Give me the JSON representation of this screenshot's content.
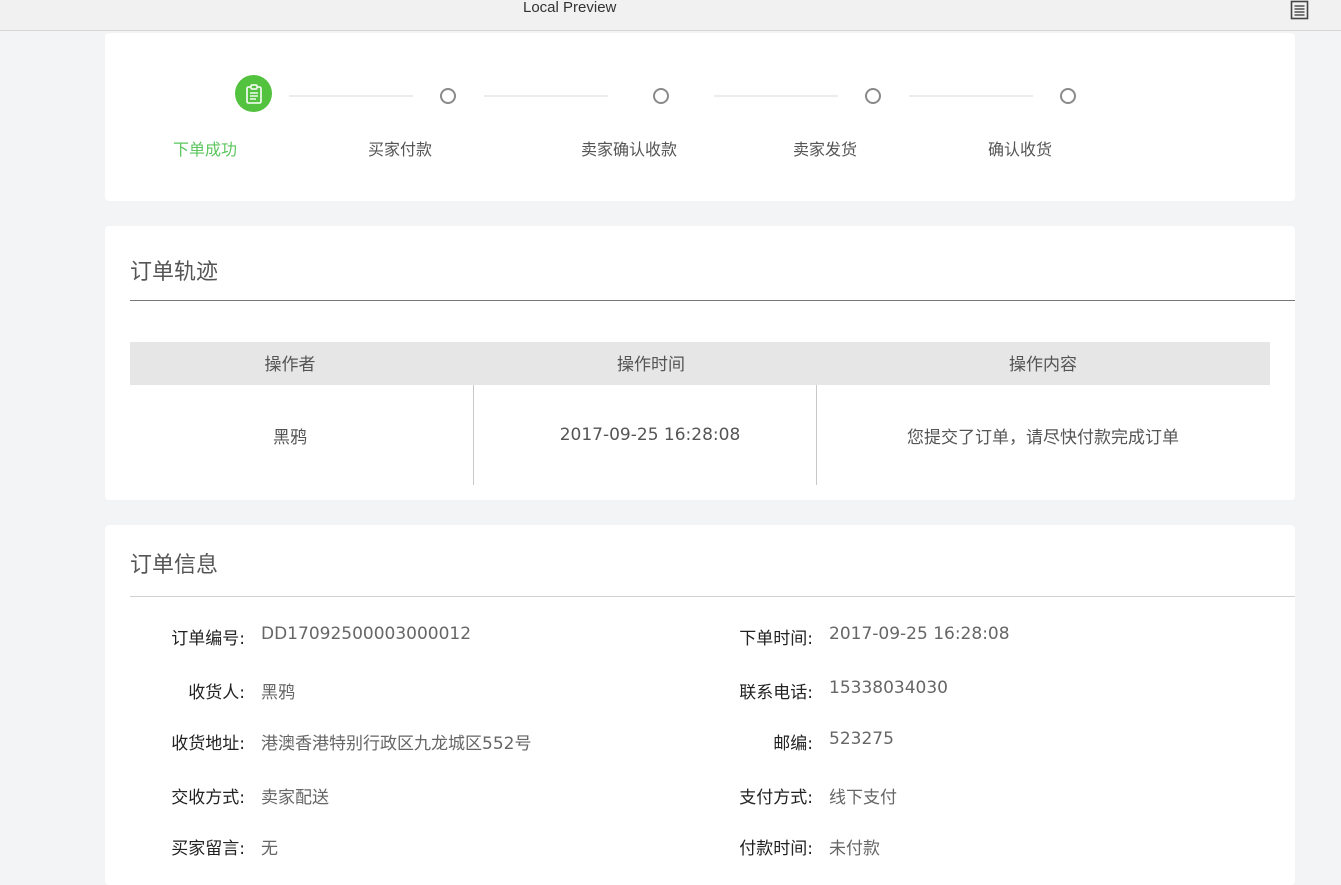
{
  "window": {
    "title": "Local Preview",
    "menu_icon": "document-icon"
  },
  "progress": {
    "steps": [
      {
        "label": "下单成功",
        "state": "active",
        "icon": "clipboard-icon"
      },
      {
        "label": "买家付款",
        "state": "pending"
      },
      {
        "label": "卖家确认收款",
        "state": "pending"
      },
      {
        "label": "卖家发货",
        "state": "pending"
      },
      {
        "label": "确认收货",
        "state": "pending"
      }
    ],
    "active_color": "#52c23f"
  },
  "track": {
    "title": "订单轨迹",
    "columns": [
      "操作者",
      "操作时间",
      "操作内容"
    ],
    "rows": [
      {
        "operator": "黑鸦",
        "time": "2017-09-25 16:28:08",
        "content": "您提交了订单，请尽快付款完成订单"
      }
    ]
  },
  "info": {
    "title": "订单信息",
    "fields": [
      {
        "label": "订单编号:",
        "value": "DD17092500003000012"
      },
      {
        "label": "下单时间:",
        "value": "2017-09-25 16:28:08"
      },
      {
        "label": "收货人:",
        "value": "黑鸦"
      },
      {
        "label": "联系电话:",
        "value": "15338034030"
      },
      {
        "label": "收货地址:",
        "value": "港澳香港特别行政区九龙城区552号"
      },
      {
        "label": "邮编:",
        "value": "523275"
      },
      {
        "label": "交收方式:",
        "value": "卖家配送"
      },
      {
        "label": "支付方式:",
        "value": "线下支付"
      },
      {
        "label": "买家留言:",
        "value": "无"
      },
      {
        "label": "付款时间:",
        "value": "未付款"
      }
    ]
  }
}
